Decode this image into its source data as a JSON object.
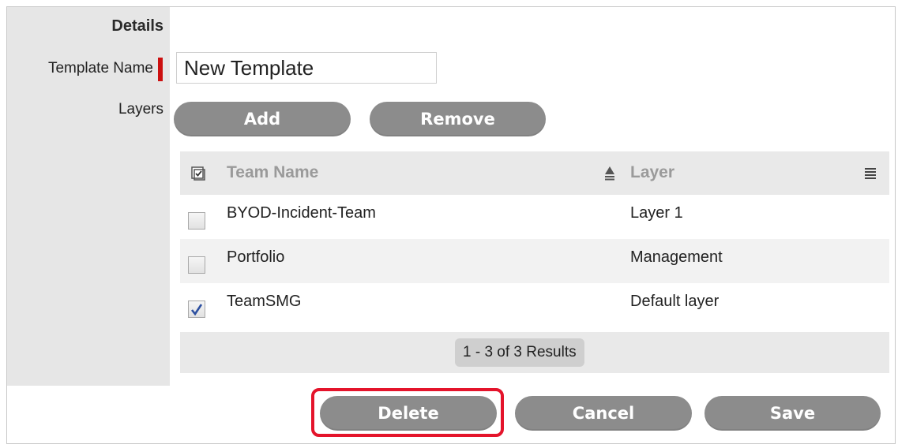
{
  "details": {
    "section_title": "Details",
    "template_name_label": "Template Name",
    "template_name_value": "New Template",
    "layers_label": "Layers"
  },
  "layer_actions": {
    "add_label": "Add",
    "remove_label": "Remove"
  },
  "grid": {
    "columns": [
      "Team Name",
      "Layer"
    ],
    "rows": [
      {
        "team": "BYOD-Incident-Team",
        "layer": "Layer 1",
        "checked": false
      },
      {
        "team": "Portfolio",
        "layer": "Management",
        "checked": false
      },
      {
        "team": "TeamSMG",
        "layer": "Default layer",
        "checked": true
      }
    ],
    "pager_text": "1 - 3 of 3 Results"
  },
  "footer": {
    "delete_label": "Delete",
    "cancel_label": "Cancel",
    "save_label": "Save"
  },
  "colors": {
    "button_bg": "#8c8c8c",
    "required_marker": "#cc1010",
    "highlight_outline": "#e4142b",
    "checkbox_check": "#2c4fa0"
  }
}
